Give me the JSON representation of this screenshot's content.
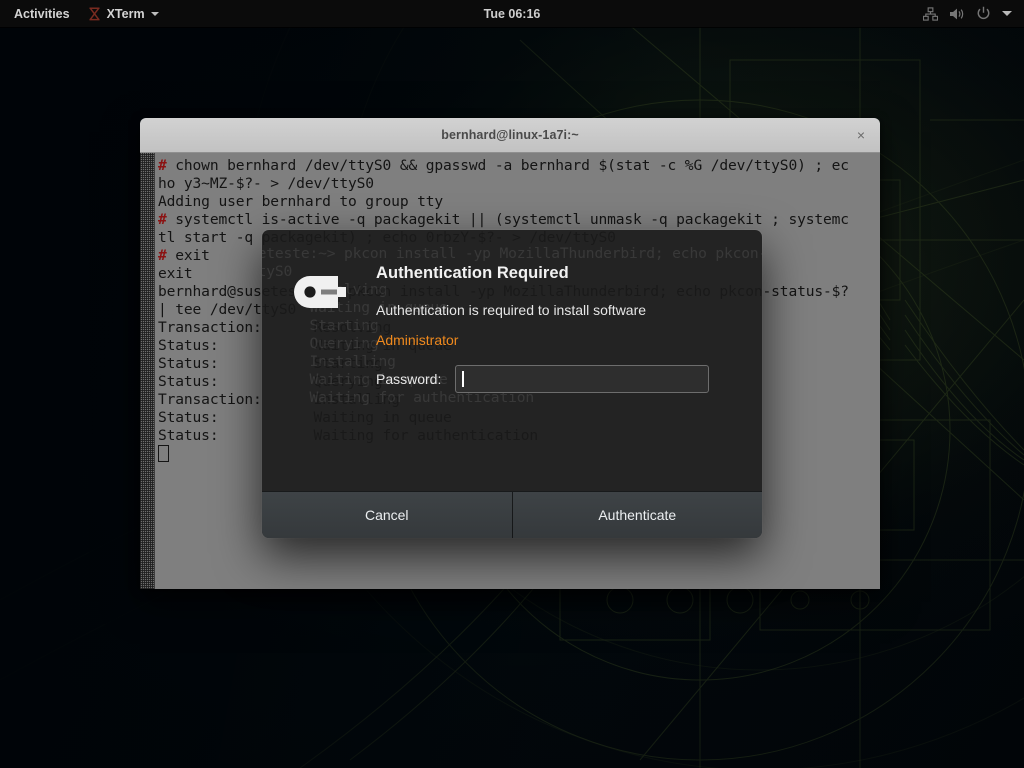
{
  "topbar": {
    "activities_label": "Activities",
    "app_menu_label": "XTerm",
    "app_icon": "xterm-logo-icon",
    "app_menu_caret": "chevron-down-icon",
    "clock": "Tue 06:16",
    "status_icons": [
      "network-wired-icon",
      "volume-icon",
      "power-icon",
      "chevron-down-icon"
    ]
  },
  "terminal": {
    "title": "bernhard@linux-1a7i:~",
    "close_label": "×",
    "prompt_symbol": "#",
    "lines": [
      {
        "prompt": true,
        "text": " chown bernhard /dev/ttyS0 && gpasswd -a bernhard $(stat -c %G /dev/ttyS0) ; ec"
      },
      {
        "prompt": false,
        "text": "ho y3~MZ-$?- > /dev/ttyS0"
      },
      {
        "prompt": false,
        "text": "Adding user bernhard to group tty"
      },
      {
        "prompt": true,
        "text": " systemctl is-active -q packagekit || (systemctl unmask -q packagekit ; systemc"
      },
      {
        "prompt": false,
        "text": "tl start -q packagekit) ; echo 0rbzY-$?- > /dev/ttyS0"
      },
      {
        "prompt": true,
        "text": " exit"
      },
      {
        "prompt": false,
        "text": "exit"
      },
      {
        "prompt": false,
        "text": "bernhard@suseteste:~> pkcon install -yp MozillaThunderbird; echo pkcon-status-$?"
      },
      {
        "prompt": false,
        "text": "| tee /dev/ttyS0"
      },
      {
        "prompt": false,
        "text": "Transaction:      Resolving"
      },
      {
        "prompt": false,
        "text": "Status:           Waiting in queue"
      },
      {
        "prompt": false,
        "text": "Status:           Starting"
      },
      {
        "prompt": false,
        "text": "Status:           Querying"
      },
      {
        "prompt": false,
        "text": "Transaction:      Installing"
      },
      {
        "prompt": false,
        "text": "Status:           Waiting in queue"
      },
      {
        "prompt": false,
        "text": "Status:           Waiting for authentication"
      }
    ],
    "cursor": "block-cursor"
  },
  "auth_dialog": {
    "icon": "key-icon",
    "title": "Authentication Required",
    "message": "Authentication is required to install software",
    "identity": "Administrator",
    "identity_color": "#f08a1e",
    "password_label": "Password:",
    "password_value": "",
    "password_placeholder": "",
    "cancel_label": "Cancel",
    "authenticate_label": "Authenticate"
  }
}
